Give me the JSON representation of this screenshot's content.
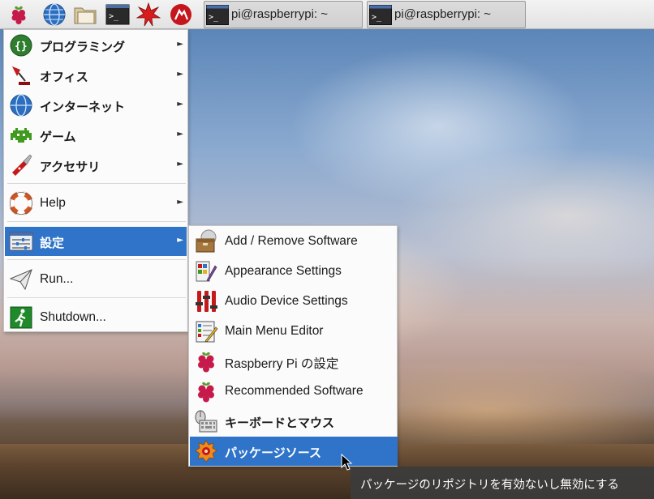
{
  "taskbar": {
    "launchers": [
      {
        "icon": "raspberry-menu-icon"
      },
      {
        "icon": "globe-web-browser-icon"
      },
      {
        "icon": "folder-file-manager-icon"
      },
      {
        "icon": "terminal-icon"
      },
      {
        "icon": "mathematica-star-icon"
      },
      {
        "icon": "wolfram-icon"
      }
    ],
    "tasks": [
      {
        "label": "pi@raspberrypi: ~"
      },
      {
        "label": "pi@raspberrypi: ~"
      }
    ]
  },
  "main_menu": {
    "items": [
      {
        "label": "プログラミング",
        "icon": "programming-braces-icon",
        "has_submenu": true
      },
      {
        "label": "オフィス",
        "icon": "office-lamp-icon",
        "has_submenu": true
      },
      {
        "label": "インターネット",
        "icon": "internet-globe-icon",
        "has_submenu": true
      },
      {
        "label": "ゲーム",
        "icon": "game-invader-icon",
        "has_submenu": true
      },
      {
        "label": "アクセサリ",
        "icon": "accessories-knife-icon",
        "has_submenu": true
      },
      {
        "label": "Help",
        "icon": "help-lifebuoy-icon",
        "has_submenu": true
      },
      {
        "label": "設定",
        "icon": "preferences-sliders-icon",
        "has_submenu": true,
        "selected": true
      },
      {
        "label": "Run...",
        "icon": "run-paper-plane-icon",
        "has_submenu": false
      },
      {
        "label": "Shutdown...",
        "icon": "shutdown-exit-icon",
        "has_submenu": false
      }
    ]
  },
  "preferences_submenu": {
    "items": [
      {
        "label": "Add / Remove Software",
        "icon": "package-box-icon"
      },
      {
        "label": "Appearance Settings",
        "icon": "appearance-palette-icon"
      },
      {
        "label": "Audio Device Settings",
        "icon": "audio-mixer-icon"
      },
      {
        "label": "Main Menu Editor",
        "icon": "menu-editor-icon"
      },
      {
        "label": "Raspberry Pi の設定",
        "icon": "raspberry-config-icon"
      },
      {
        "label": "Recommended Software",
        "icon": "raspberry-recommended-icon"
      },
      {
        "label": "キーボードとマウス",
        "icon": "keyboard-mouse-icon"
      },
      {
        "label": "パッケージソース",
        "icon": "package-sources-gear-icon",
        "selected": true
      }
    ]
  },
  "tooltip": {
    "text": "パッケージのリポジトリを有効ないし無効にする"
  },
  "colors": {
    "selection": "#2f74c9",
    "menu_bg": "#fbfbfb",
    "tooltip_bg": "#3c3c3c"
  }
}
